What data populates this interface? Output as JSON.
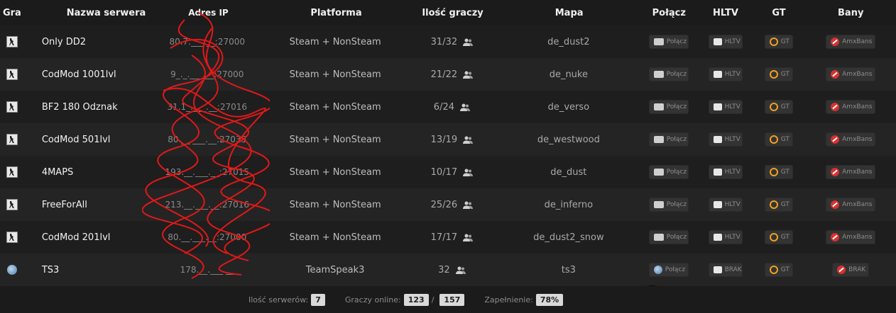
{
  "header": {
    "gra": "Gra",
    "name": "Nazwa serwera",
    "ip": "Adres IP",
    "platform": "Platforma",
    "players": "Ilość graczy",
    "map": "Mapa",
    "connect": "Połącz",
    "hltv": "HLTV",
    "gt": "GT",
    "bany": "Bany"
  },
  "servers": [
    {
      "name": "Only DD2",
      "ip": "80.7.___.__:27000",
      "platform": "Steam + NonSteam",
      "players": "31/32",
      "map": "de_dust2",
      "connect": "Połącz",
      "hltv": "HLTV",
      "gt": "GT",
      "bans": "AmxBans",
      "game_icon": "cs-icon"
    },
    {
      "name": "CodMod 1001lvl",
      "ip": "9_._.___.__:27000",
      "platform": "Steam + NonSteam",
      "players": "21/22",
      "map": "de_nuke",
      "connect": "Połącz",
      "hltv": "HLTV",
      "gt": "GT",
      "bans": "AmxBans",
      "game_icon": "cs-icon"
    },
    {
      "name": "BF2 180 Odznak",
      "ip": "31.1_.___.__:27016",
      "platform": "Steam + NonSteam",
      "players": "6/24",
      "map": "de_verso",
      "connect": "Połącz",
      "hltv": "HLTV",
      "gt": "GT",
      "bans": "AmxBans",
      "game_icon": "cs-icon"
    },
    {
      "name": "CodMod 501lvl",
      "ip": "80.__.___.__:27035",
      "platform": "Steam + NonSteam",
      "players": "13/19",
      "map": "de_westwood",
      "connect": "Połącz",
      "hltv": "HLTV",
      "gt": "GT",
      "bans": "AmxBans",
      "game_icon": "cs-icon"
    },
    {
      "name": "4MAPS",
      "ip": "193.__.___.__:27015",
      "platform": "Steam + NonSteam",
      "players": "10/17",
      "map": "de_dust",
      "connect": "Połącz",
      "hltv": "HLTV",
      "gt": "GT",
      "bans": "AmxBans",
      "game_icon": "cs-icon"
    },
    {
      "name": "FreeForAll",
      "ip": "213.__.___.__:27016",
      "platform": "Steam + NonSteam",
      "players": "25/26",
      "map": "de_inferno",
      "connect": "Połącz",
      "hltv": "HLTV",
      "gt": "GT",
      "bans": "AmxBans",
      "game_icon": "cs-icon"
    },
    {
      "name": "CodMod 201lvl",
      "ip": "80.__.___.__:27000",
      "platform": "Steam + NonSteam",
      "players": "17/17",
      "map": "de_dust2_snow",
      "connect": "Połącz",
      "hltv": "HLTV",
      "gt": "GT",
      "bans": "AmxBans",
      "game_icon": "cs-icon"
    },
    {
      "name": "TS3",
      "ip": "178.__.___.__",
      "platform": "TeamSpeak3",
      "players": "32",
      "map": "ts3",
      "connect": "Połącz",
      "hltv": "BRAK",
      "gt": "GT",
      "bans": "BRAK",
      "game_icon": "ts3-icon"
    }
  ],
  "footer": {
    "servers_label": "Ilość serwerów:",
    "servers_value": "7",
    "online_label": "Graczy online:",
    "online_value": "123",
    "separator": "/",
    "online_max": "157",
    "fill_label": "Zapełnienie:",
    "fill_value": "78%"
  }
}
